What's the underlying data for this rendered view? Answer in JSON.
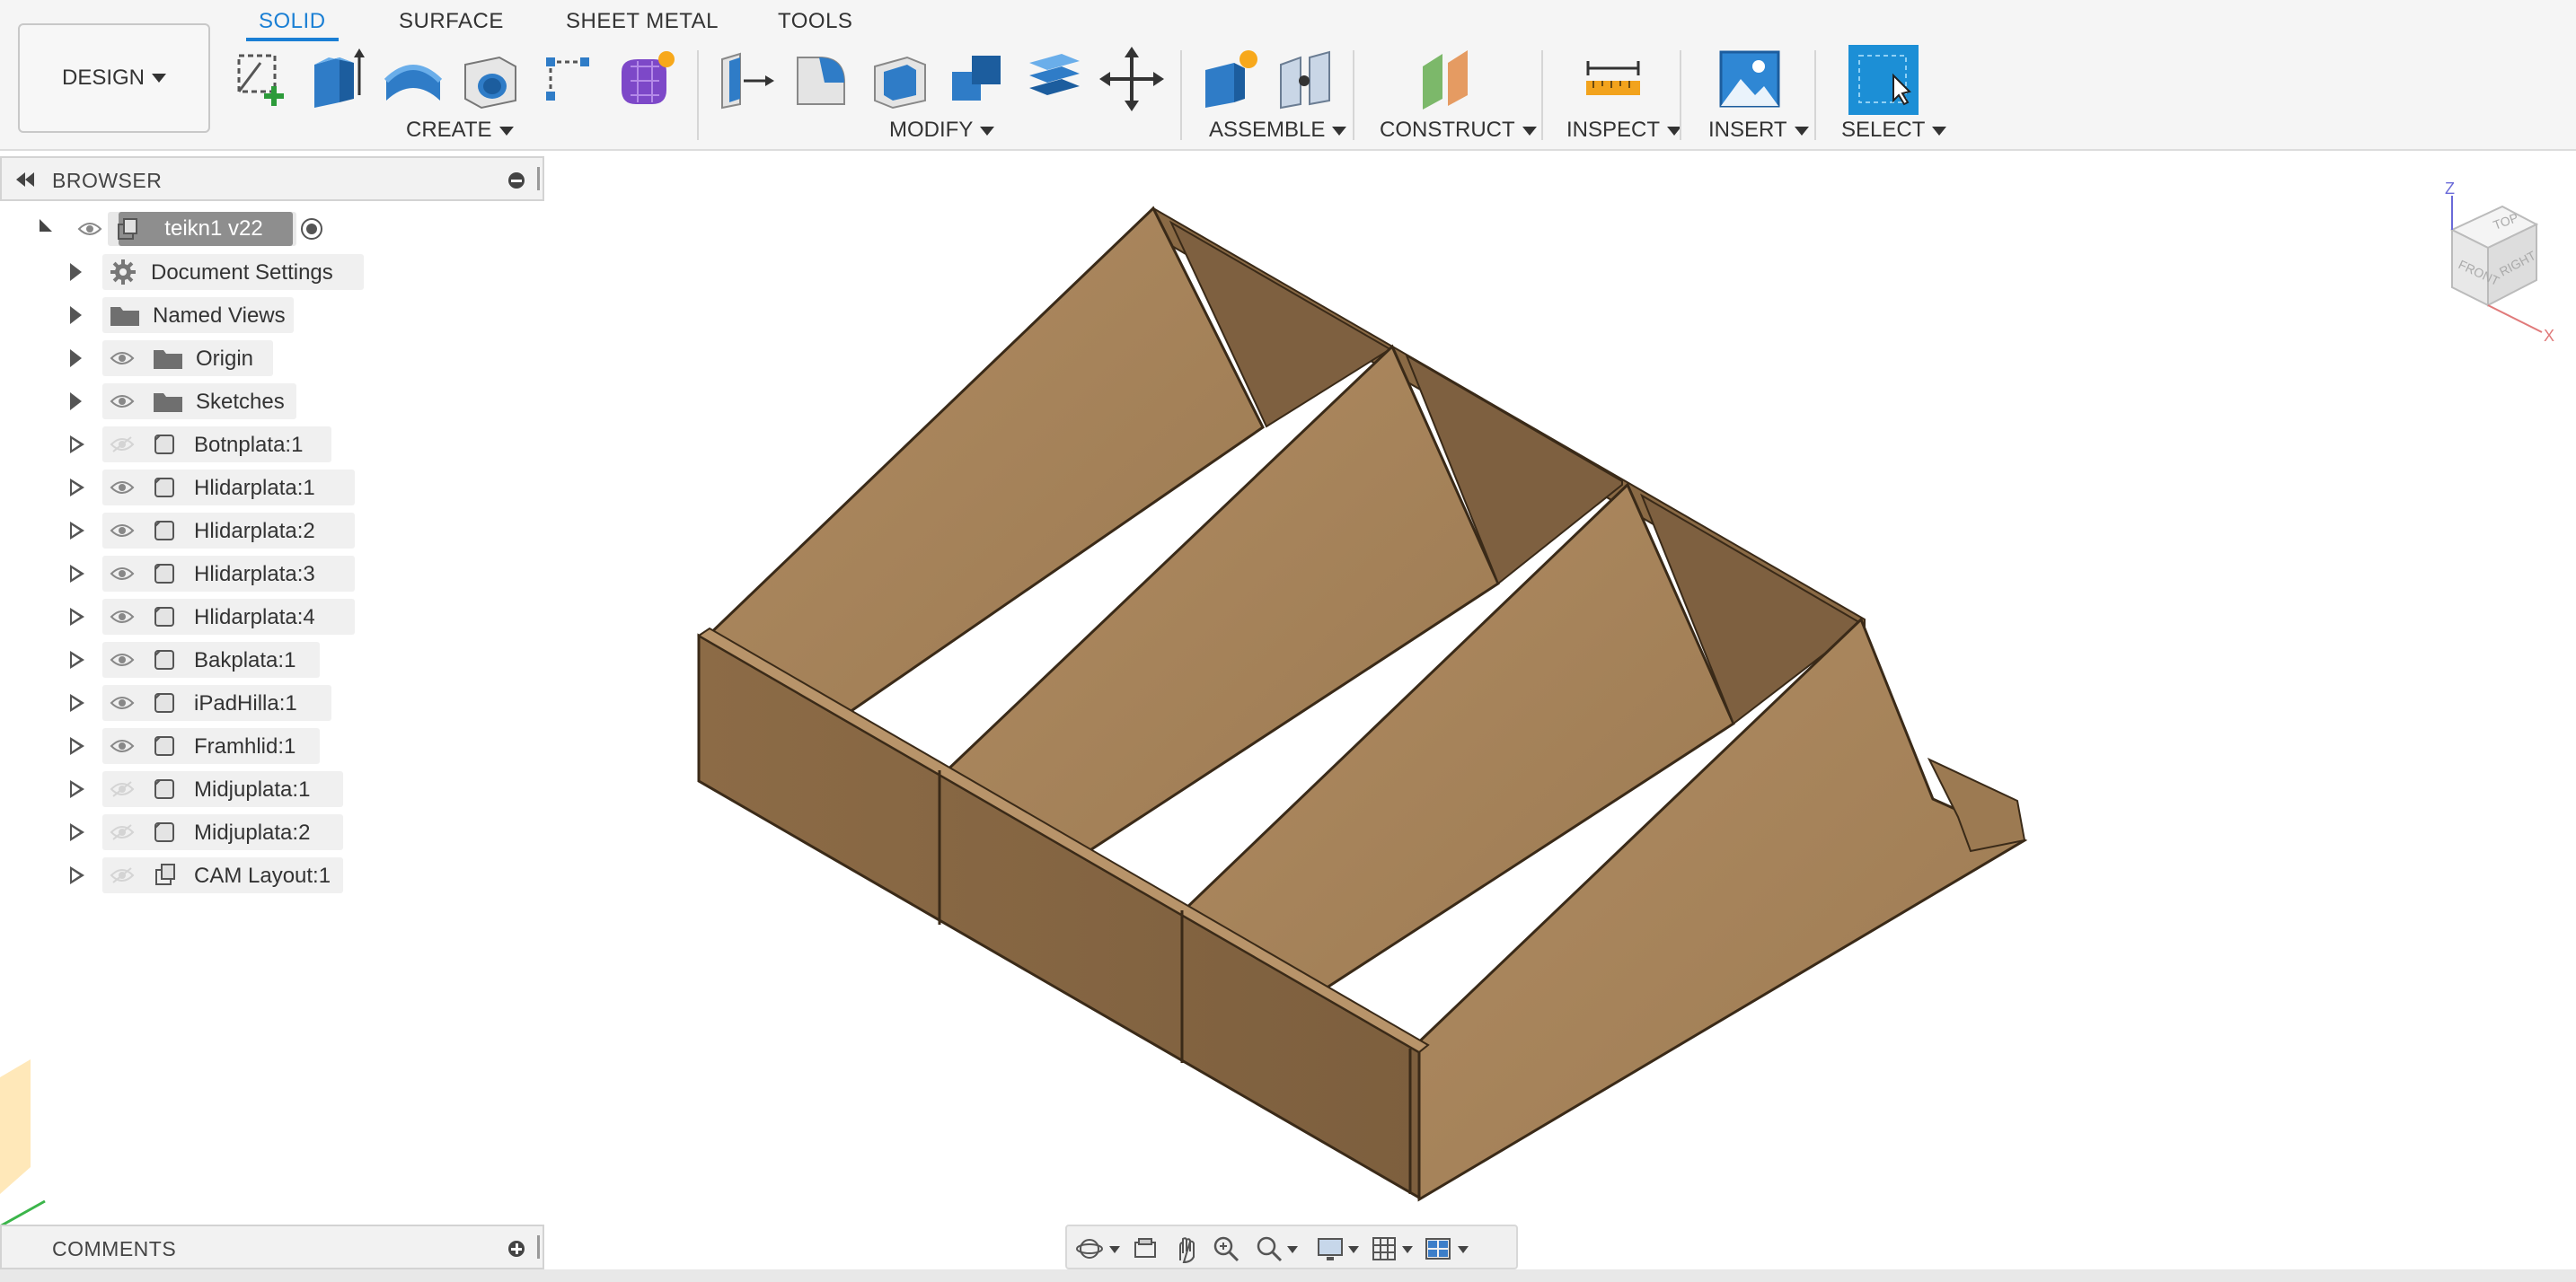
{
  "toolbar": {
    "workspace_button": "DESIGN",
    "tabs": [
      "SOLID",
      "SURFACE",
      "SHEET METAL",
      "TOOLS"
    ],
    "active_tab": "SOLID",
    "groups": {
      "create": "CREATE",
      "modify": "MODIFY",
      "assemble": "ASSEMBLE",
      "construct": "CONSTRUCT",
      "inspect": "INSPECT",
      "insert": "INSERT",
      "select": "SELECT"
    }
  },
  "browser": {
    "title": "BROWSER",
    "root": "teikn1 v22",
    "items": [
      {
        "label": "Document Settings",
        "icon": "gear-icon"
      },
      {
        "label": "Named Views",
        "icon": "folder-icon"
      },
      {
        "label": "Origin",
        "icon": "folder-icon"
      },
      {
        "label": "Sketches",
        "icon": "folder-icon"
      },
      {
        "label": "Botnplata:1",
        "icon": "body-icon",
        "visible": false
      },
      {
        "label": "Hlidarplata:1",
        "icon": "body-icon",
        "visible": true
      },
      {
        "label": "Hlidarplata:2",
        "icon": "body-icon",
        "visible": true
      },
      {
        "label": "Hlidarplata:3",
        "icon": "body-icon",
        "visible": true
      },
      {
        "label": "Hlidarplata:4",
        "icon": "body-icon",
        "visible": true
      },
      {
        "label": "Bakplata:1",
        "icon": "body-icon",
        "visible": true
      },
      {
        "label": "iPadHilla:1",
        "icon": "body-icon",
        "visible": true
      },
      {
        "label": "Framhlid:1",
        "icon": "body-icon",
        "visible": true
      },
      {
        "label": "Midjuplata:1",
        "icon": "body-icon",
        "visible": false
      },
      {
        "label": "Midjuplata:2",
        "icon": "body-icon",
        "visible": false
      },
      {
        "label": "CAM Layout:1",
        "icon": "component-icon",
        "visible": false
      }
    ]
  },
  "comments": {
    "title": "COMMENTS"
  },
  "viewcube": {
    "top": "TOP",
    "front": "FRONT",
    "right": "RIGHT",
    "z_axis": "Z",
    "x_axis": "X"
  },
  "colors": {
    "accent": "#1a7fd4",
    "select_tile": "#1c8fd6",
    "wood": "#a8845c"
  }
}
